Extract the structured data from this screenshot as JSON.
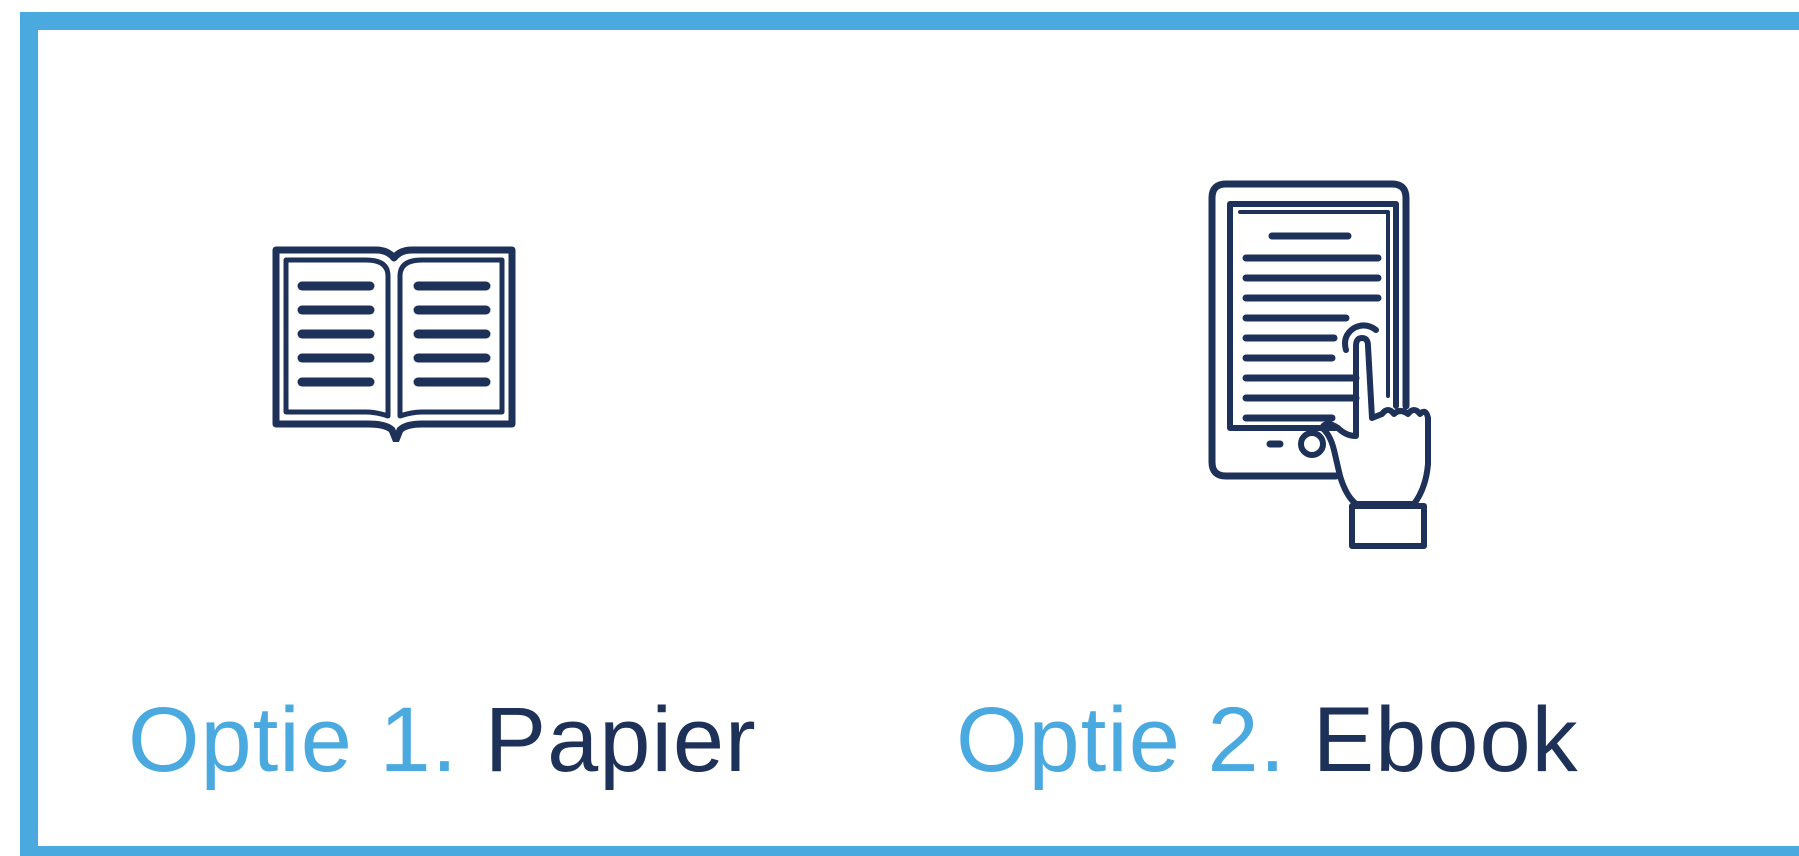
{
  "options": [
    {
      "prefix": "Optie 1.",
      "name": "Papier",
      "icon": "open-book-icon"
    },
    {
      "prefix": "Optie 2.",
      "name": "Ebook",
      "icon": "ereader-hand-icon"
    }
  ],
  "colors": {
    "accent": "#4aaadf",
    "navy": "#1e3158",
    "background": "#ffffff"
  }
}
